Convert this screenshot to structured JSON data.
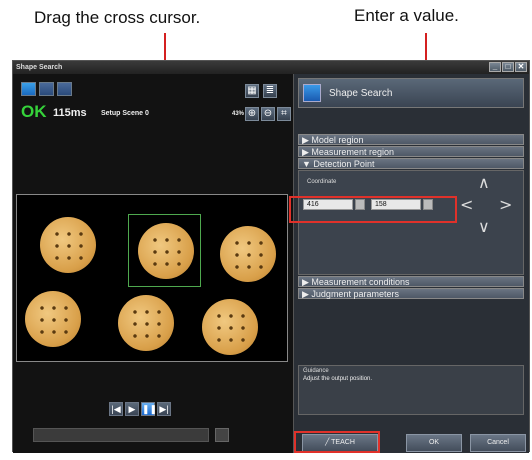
{
  "callouts": {
    "left_text": "Drag the cross cursor.",
    "right_text": "Enter a value."
  },
  "window": {
    "title": "Shape Search",
    "min_icon": "minimize-icon",
    "max_icon": "maximize-icon",
    "close_icon": "close-icon",
    "min_glyph": "_",
    "max_glyph": "□",
    "close_glyph": "✕"
  },
  "left_panel": {
    "status": "OK",
    "time": "115ms",
    "scene": "Setup Scene 0",
    "zoom": "43%",
    "zoom_in_glyph": "⊕",
    "zoom_out_glyph": "⊖",
    "fit_glyph": "⌗",
    "grid_glyph": "▦",
    "list_glyph": "≣",
    "prev_glyph": "|◀",
    "play_glyph": "▶",
    "pause_glyph": "❚❚",
    "next_glyph": "▶|"
  },
  "right_panel": {
    "header_title": "Shape Search",
    "items": [
      "▶ Model region",
      "▶ Measurement region",
      "▼ Detection Point"
    ],
    "coordinate_label": "Coordinate",
    "x_value": "416",
    "y_value": "158",
    "items_after": [
      "▶ Measurement conditions",
      "▶ Judgment parameters"
    ],
    "guidance_label": "Guidance",
    "guidance_text": "Adjust the output position.",
    "teach_label": "TEACH",
    "ok_label": "OK",
    "cancel_label": "Cancel"
  },
  "colors": {
    "ok_green": "#35d23a",
    "callout_red": "#e0312a"
  }
}
